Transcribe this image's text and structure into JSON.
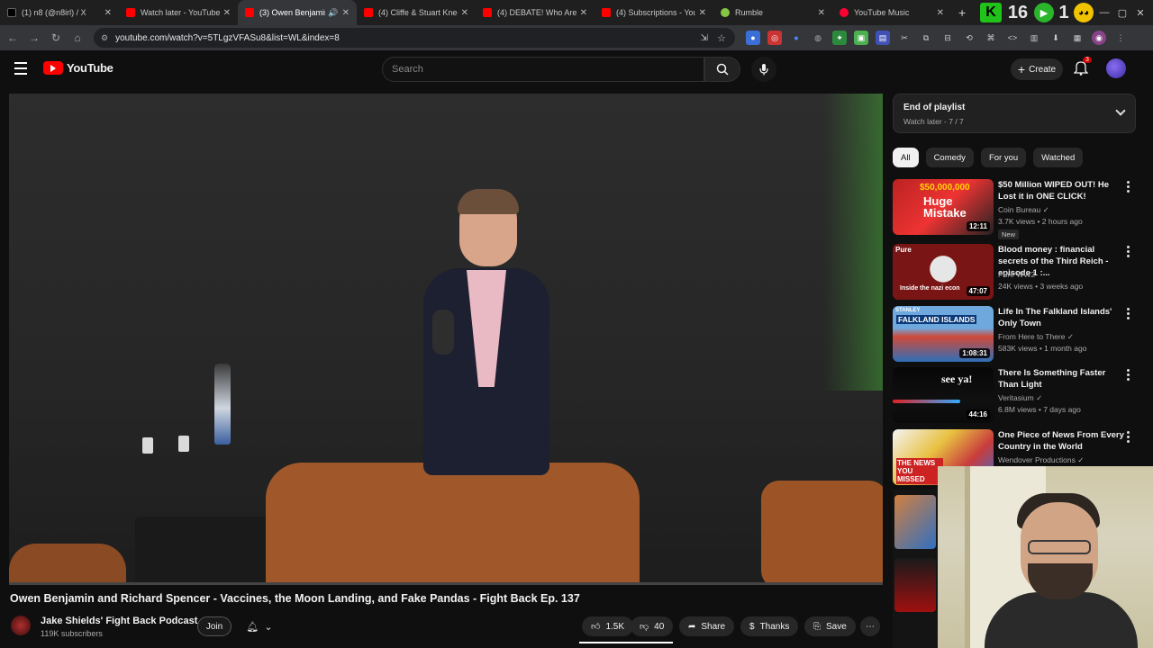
{
  "browser": {
    "tabs": [
      {
        "title": "(1) n8 (@n8irl) / X",
        "color": "#000000"
      },
      {
        "title": "Watch later - YouTube",
        "color": "#ff0000"
      },
      {
        "title": "(3) Owen Benjamin",
        "color": "#ff0000",
        "active": true
      },
      {
        "title": "(4) Cliffe & Stuart Knech",
        "color": "#ff0000"
      },
      {
        "title": "(4) DEBATE! Who Are th",
        "color": "#ff0000"
      },
      {
        "title": "(4) Subscriptions - YouT",
        "color": "#ff0000"
      },
      {
        "title": "Rumble",
        "color": "#85c742"
      },
      {
        "title": "YouTube Music",
        "color": "#ff0033"
      }
    ],
    "url": "youtube.com/watch?v=5TLgzVFASu8&list=WL&index=8",
    "tabbar_digits": [
      "16",
      "1"
    ]
  },
  "youtube": {
    "logo_text": "YouTube",
    "search_placeholder": "Search",
    "create_label": "Create",
    "notification_count": "3"
  },
  "video": {
    "title": "Owen Benjamin and Richard Spencer - Vaccines, the Moon Landing, and Fake Pandas - Fight Back Ep. 137",
    "channel": "Jake Shields' Fight Back Podcast",
    "subscribers": "119K subscribers",
    "join_label": "Join",
    "likes": "1.5K",
    "dislikes": "40",
    "share_label": "Share",
    "thanks_label": "Thanks",
    "save_label": "Save"
  },
  "playlist": {
    "title": "End of playlist",
    "subtitle": "Watch later - 7 / 7"
  },
  "chips": [
    "All",
    "Comedy",
    "For you",
    "Watched"
  ],
  "recommendations": [
    {
      "title": "$50 Million WIPED OUT! He Lost it in ONE CLICK!",
      "channel": "Coin Bureau",
      "meta": "3.7K views • 2 hours ago",
      "duration": "12:11",
      "badge": "New",
      "thumb_text": "Huge Mistake",
      "thumb_text2": "$50,000,000"
    },
    {
      "title": "Blood money : financial secrets of the Third Reich - episode 1 :...",
      "channel": "Pure WW2",
      "meta": "24K views • 3 weeks ago",
      "duration": "47:07",
      "thumb_text": "Inside the nazi econ",
      "thumb_text2": "Pure"
    },
    {
      "title": "Life In The Falkland Islands' Only Town",
      "channel": "From Here to There",
      "meta": "583K views • 1 month ago",
      "duration": "1:08:31",
      "thumb_text": "FALKLAND ISLANDS",
      "thumb_text2": "STANLEY"
    },
    {
      "title": "There Is Something Faster Than Light",
      "channel": "Veritasium",
      "meta": "6.8M views • 7 days ago",
      "duration": "44:16",
      "thumb_text": "see ya!"
    },
    {
      "title": "One Piece of News From Every Country in the World",
      "channel": "Wendover Productions",
      "meta": "",
      "duration": "",
      "thumb_text": "THE NEWS YOU MISSED"
    }
  ]
}
